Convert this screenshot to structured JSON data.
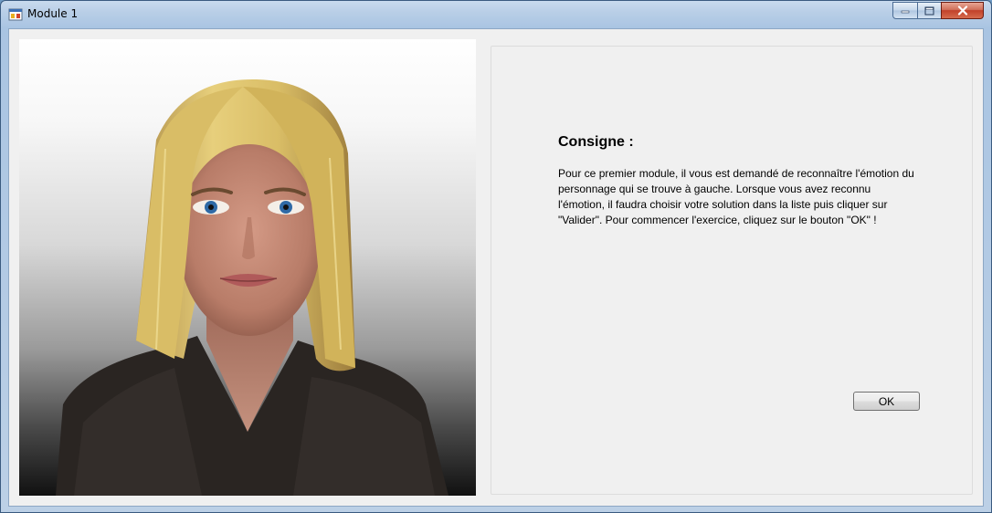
{
  "window": {
    "title": "Module 1",
    "icons": {
      "app": "app-icon",
      "minimize": "minimize-icon",
      "maximize": "maximize-icon",
      "close": "close-icon"
    }
  },
  "stimulus": {
    "image": "avatar-face-portrait"
  },
  "panel": {
    "heading": "Consigne :",
    "instructions": "Pour ce premier module, il vous est demandé de reconnaître l'émotion du personnage qui se trouve à gauche. Lorsque vous avez reconnu l'émotion, il faudra choisir votre solution dans la liste puis cliquer sur \"Valider\". Pour commencer l'exercice, cliquez sur le bouton \"OK\" !",
    "ok_label": "OK"
  },
  "colors": {
    "title_bar": "#b9cfe7",
    "close_button": "#c2412a",
    "client_background": "#f0f0f0"
  }
}
